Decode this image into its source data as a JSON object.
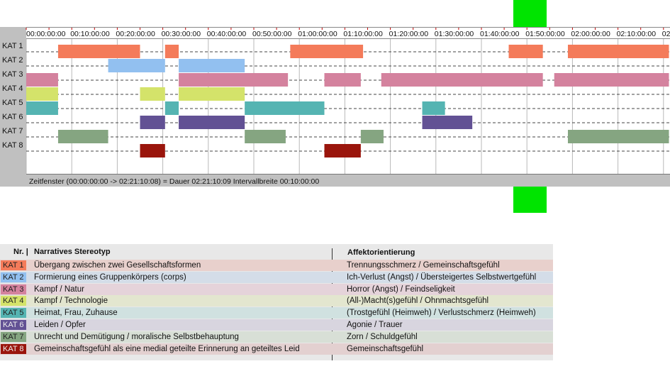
{
  "timeline": {
    "ticks": [
      "00:00:00:00",
      "00:10:00:00",
      "00:20:00:00",
      "00:30:00:00",
      "00:40:00:00",
      "00:50:00:00",
      "01:00:00:00",
      "01:10:00:00",
      "01:20:00:00",
      "01:30:00:00",
      "01:40:00:00",
      "01:50:00:00",
      "02:00:00:00",
      "02:10:00:00",
      "02"
    ],
    "rows": [
      "KAT 1",
      "KAT 2",
      "KAT 3",
      "KAT 4",
      "KAT 5",
      "KAT 6",
      "KAT 7",
      "KAT 8"
    ],
    "colors": [
      "#f47b5a",
      "#92c0f0",
      "#d4829e",
      "#d4e36a",
      "#55b4b2",
      "#625194",
      "#85a581",
      "#9a150c"
    ],
    "segments": [
      [
        [
          7,
          25
        ],
        [
          30.5,
          33.5
        ],
        [
          58,
          74
        ],
        [
          106,
          113.5
        ],
        [
          119,
          141.2
        ]
      ],
      [
        [
          18,
          30.5
        ],
        [
          33.5,
          48
        ]
      ],
      [
        [
          0,
          7
        ],
        [
          33.5,
          57.5
        ],
        [
          65.5,
          73.5
        ],
        [
          78,
          113.5
        ],
        [
          116,
          141.2
        ]
      ],
      [
        [
          0,
          7
        ],
        [
          25,
          30.5
        ],
        [
          33.5,
          48
        ]
      ],
      [
        [
          0,
          7
        ],
        [
          30.5,
          33.5
        ],
        [
          48,
          65.5
        ],
        [
          87,
          92
        ]
      ],
      [
        [
          25,
          30.5
        ],
        [
          33.5,
          48
        ],
        [
          87,
          98
        ]
      ],
      [
        [
          7,
          18
        ],
        [
          48,
          57
        ],
        [
          73.5,
          78.5
        ],
        [
          119,
          141.2
        ]
      ],
      [
        [
          25,
          30.5
        ],
        [
          65.5,
          73.5
        ]
      ]
    ],
    "status": "Zeitfenster (00:00:00:00 -> 02:21:10:08) = Dauer 02:21:10:09    Intervallbreite 00:10:00:00"
  },
  "legend": {
    "header": {
      "nr": "Nr. |",
      "stereotyp": "Narratives Stereotyp",
      "affekt": "Affektorientierung"
    },
    "rows": [
      {
        "kat": "KAT 1",
        "stereotyp": "Übergang zwischen zwei Gesellschaftsformen",
        "affekt": "Trennungsschmerz / Gemeinschaftsgefühl",
        "color": "#f47b5a",
        "bg": "#e8d0cc"
      },
      {
        "kat": "KAT 2",
        "stereotyp": "Formierung eines Gruppenkörpers (corps)",
        "affekt": "Ich-Verlust (Angst) / Übersteigertes Selbstwertgefühl",
        "color": "#92c0f0",
        "bg": "#d4dde8"
      },
      {
        "kat": "KAT 3",
        "stereotyp": "Kampf / Natur",
        "affekt": "Horror (Angst) / Feindseligkeit",
        "color": "#d4829e",
        "bg": "#e5d3da"
      },
      {
        "kat": "KAT 4",
        "stereotyp": "Kampf / Technologie",
        "affekt": "(All-)Macht(s)gefühl / Ohnmachtsgefühl",
        "color": "#d4e36a",
        "bg": "#e3e6cf"
      },
      {
        "kat": "KAT 5",
        "stereotyp": "Heimat, Frau, Zuhause",
        "affekt": "(Trostgefühl (Heimweh) / Verlustschmerz (Heimweh)",
        "color": "#55b4b2",
        "bg": "#d0e1e0"
      },
      {
        "kat": "KAT 6",
        "stereotyp": "Leiden / Opfer",
        "affekt": "Agonie / Trauer",
        "color": "#625194",
        "bg": "#d8d5df"
      },
      {
        "kat": "KAT 7",
        "stereotyp": "Unrecht und Demütigung / moralische Selbstbehauptung",
        "affekt": "Zorn / Schuldgefühl",
        "color": "#85a581",
        "bg": "#d8dfd6"
      },
      {
        "kat": "KAT 8",
        "stereotyp": "Gemeinschaftsgefühl als eine medial geteilte Erinnerung an geteiltes Leid",
        "affekt": "Gemeinschaftsgefühl",
        "color": "#9a150c",
        "bg": "#e3d0d0"
      }
    ]
  }
}
